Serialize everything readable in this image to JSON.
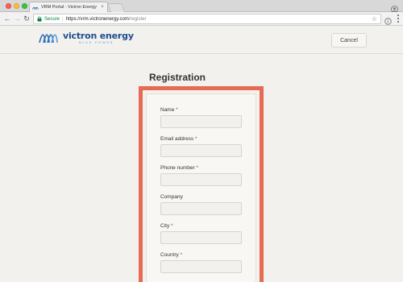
{
  "browser": {
    "tab_title": "VRM Portal - Victron Energy",
    "tab_close": "×",
    "secure_label": "Secure",
    "url_main": "https://vrm.victronenergy.com",
    "url_path": "/register",
    "icons": [
      "back-arrow-icon",
      "forward-arrow-icon",
      "reload-icon",
      "lock-icon",
      "star-icon",
      "info-icon",
      "menu-icon",
      "profile-icon"
    ]
  },
  "header": {
    "logo_name": "victron energy",
    "logo_tagline": "BLUE POWER",
    "cancel_label": "Cancel"
  },
  "page": {
    "title": "Registration"
  },
  "form": {
    "fields": [
      {
        "label": "Name",
        "required": "*",
        "value": ""
      },
      {
        "label": "Email address",
        "required": "*",
        "value": ""
      },
      {
        "label": "Phone number",
        "required": "*",
        "value": ""
      },
      {
        "label": "Company",
        "required": "",
        "value": ""
      },
      {
        "label": "City",
        "required": "*",
        "value": ""
      },
      {
        "label": "Country",
        "required": "*",
        "value": ""
      }
    ]
  },
  "colors": {
    "highlight": "#e56b52",
    "brand_blue": "#1e4e8c",
    "secure_green": "#0b8043",
    "required_red": "#c0392b"
  }
}
